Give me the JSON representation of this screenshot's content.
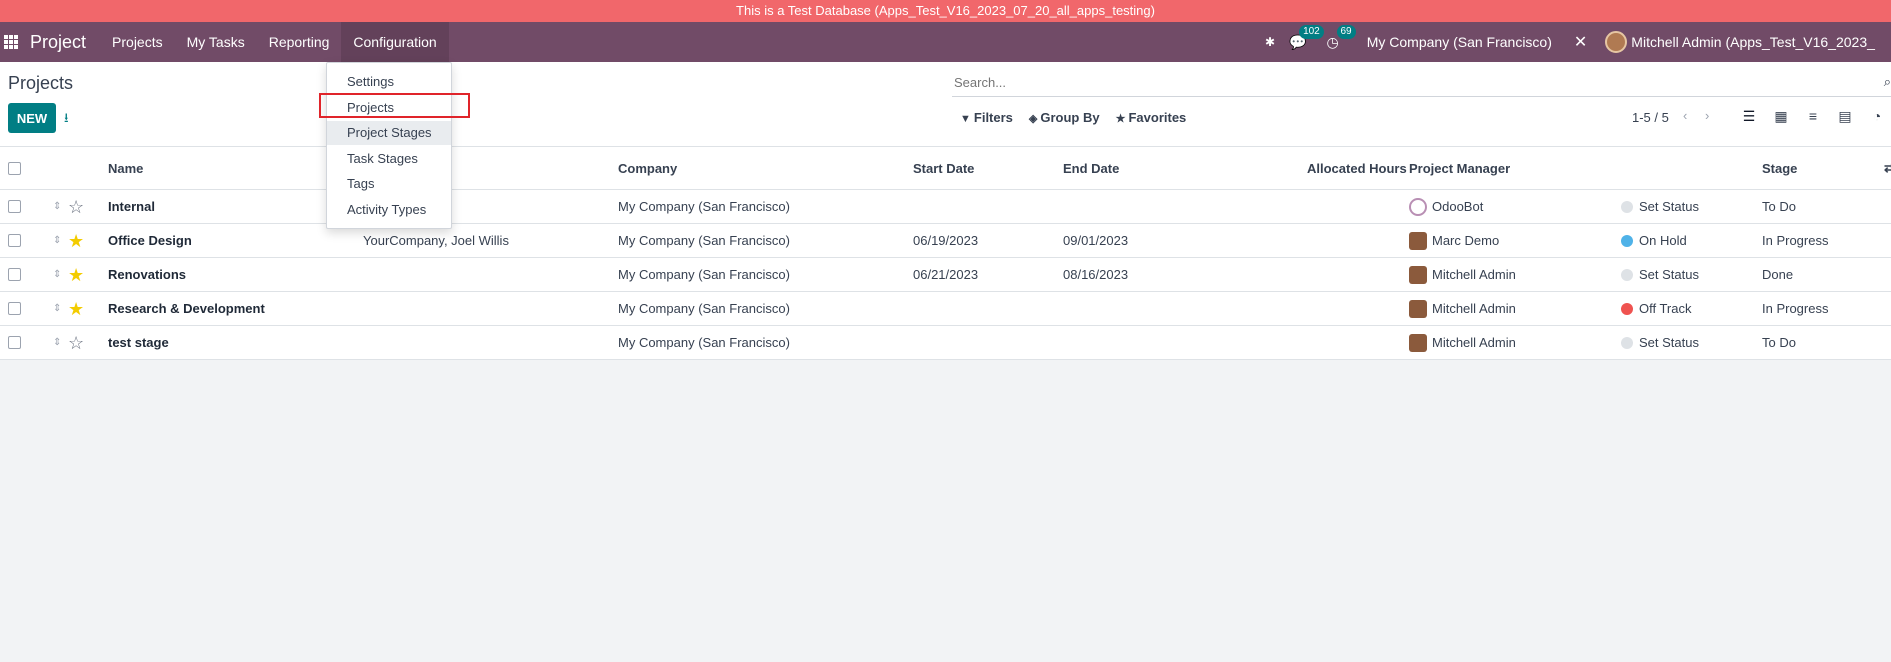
{
  "banner": {
    "text": "This is a Test Database (Apps_Test_V16_2023_07_20_all_apps_testing)"
  },
  "navbar": {
    "app_name": "Project",
    "menu": [
      "Projects",
      "My Tasks",
      "Reporting",
      "Configuration"
    ],
    "messages_count": "102",
    "activities_count": "69",
    "company": "My Company (San Francisco)",
    "user": "Mitchell Admin (Apps_Test_V16_2023_"
  },
  "page": {
    "title": "Projects",
    "new_label": "NEW"
  },
  "search": {
    "placeholder": "Search..."
  },
  "filters": {
    "filters": "Filters",
    "group_by": "Group By",
    "favorites": "Favorites"
  },
  "pager": {
    "text": "1-5 / 5"
  },
  "dropdown": {
    "items": [
      "Settings",
      "Projects",
      "Project Stages",
      "Task Stages",
      "Tags",
      "Activity Types"
    ]
  },
  "table": {
    "columns": [
      "Name",
      "Company",
      "Start Date",
      "End Date",
      "Allocated Hours",
      "Project Manager",
      "Stage"
    ],
    "rows": [
      {
        "name": "Internal",
        "customer": "",
        "company": "My Company (San Francisco)",
        "start": "",
        "end": "",
        "manager": "OdooBot",
        "status": "Set Status",
        "status_color": "#dee2e6",
        "stage": "To Do",
        "favorite": false
      },
      {
        "name": "Office Design",
        "customer": "YourCompany, Joel Willis",
        "company": "My Company (San Francisco)",
        "start": "06/19/2023",
        "end": "09/01/2023",
        "manager": "Marc Demo",
        "status": "On Hold",
        "status_color": "#4fb2e8",
        "stage": "In Progress",
        "favorite": true
      },
      {
        "name": "Renovations",
        "customer": "",
        "company": "My Company (San Francisco)",
        "start": "06/21/2023",
        "end": "08/16/2023",
        "manager": "Mitchell Admin",
        "status": "Set Status",
        "status_color": "#dee2e6",
        "stage": "Done",
        "favorite": true
      },
      {
        "name": "Research & Development",
        "customer": "",
        "company": "My Company (San Francisco)",
        "start": "",
        "end": "",
        "manager": "Mitchell Admin",
        "status": "Off Track",
        "status_color": "#ef5350",
        "stage": "In Progress",
        "favorite": true
      },
      {
        "name": "test stage",
        "customer": "",
        "company": "My Company (San Francisco)",
        "start": "",
        "end": "",
        "manager": "Mitchell Admin",
        "status": "Set Status",
        "status_color": "#dee2e6",
        "stage": "To Do",
        "favorite": false
      }
    ]
  },
  "colors": {
    "navbar": "#714b67",
    "primary": "#017e84",
    "banner": "#f1676b",
    "star": "#f3cc00"
  }
}
